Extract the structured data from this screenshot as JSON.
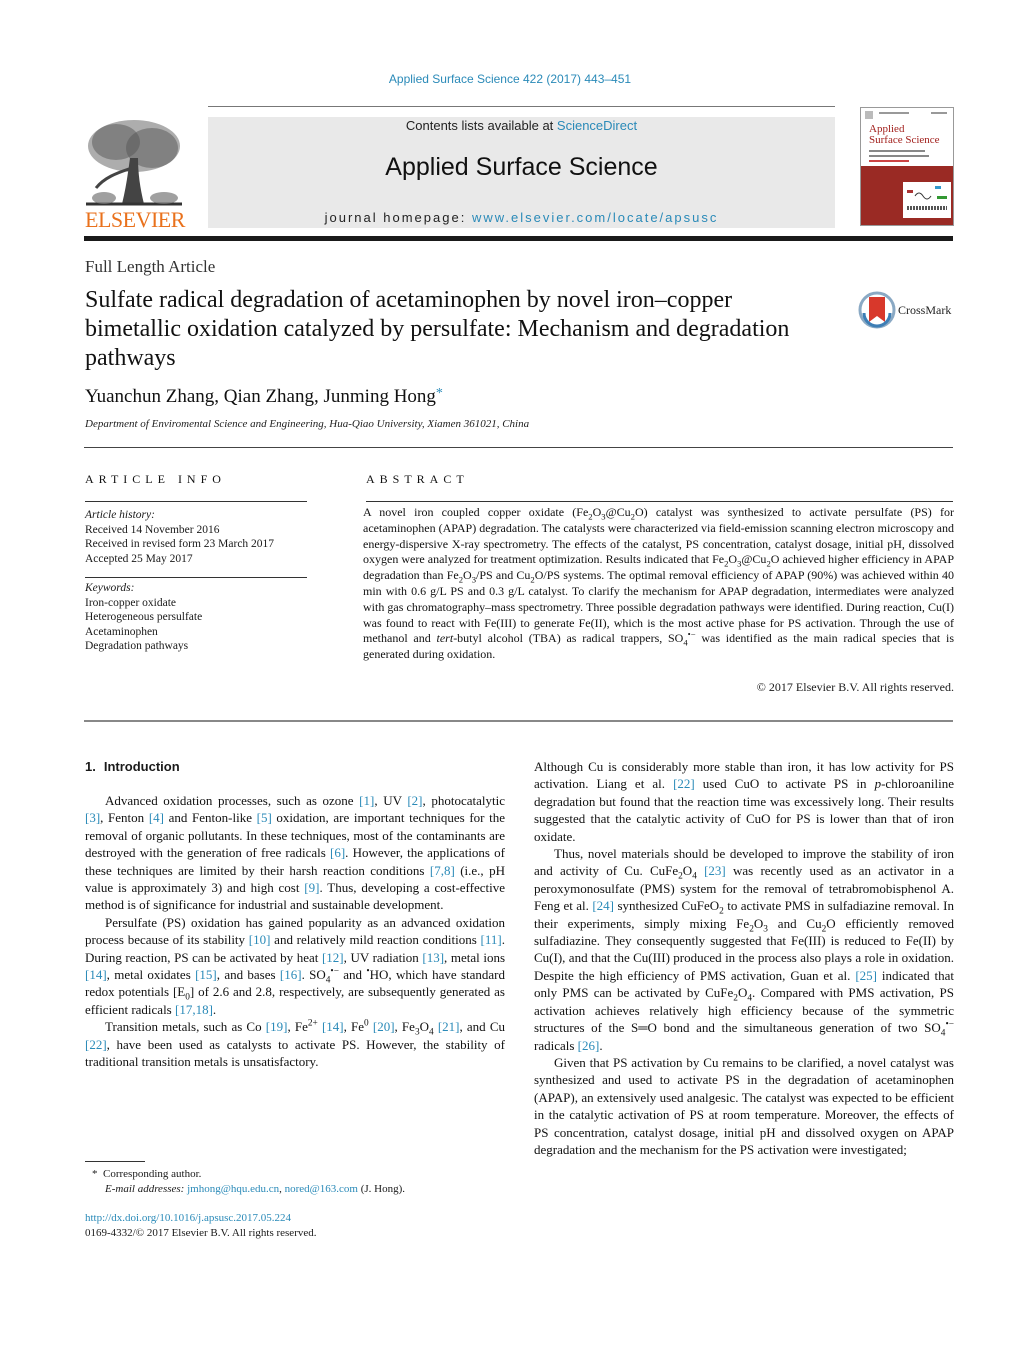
{
  "header": {
    "journal_reference": "Applied Surface Science 422 (2017) 443–451",
    "contents_prefix": "Contents lists available at ",
    "contents_link": "ScienceDirect",
    "journal_title": "Applied Surface Science",
    "homepage_prefix": "journal homepage: ",
    "homepage_link": "www.elsevier.com/locate/apsusc",
    "publisher_logo_text": "ELSEVIER",
    "cover_title_line1": "Applied",
    "cover_title_line2": "Surface Science",
    "colors": {
      "link": "#2a8ab8",
      "elsevier_orange": "#e9711c",
      "cover_red": "#9a2a24"
    }
  },
  "article": {
    "type": "Full Length Article",
    "title": "Sulfate radical degradation of acetaminophen by novel iron–copper bimetallic oxidation catalyzed by persulfate: Mechanism and degradation pathways",
    "crossmark_label": "CrossMark",
    "authors": "Yuanchun Zhang, Qian Zhang, Junming Hong",
    "corresponding_marker": "*",
    "affiliation": "Department of Enviromental Science and Engineering, Hua-Qiao University, Xiamen 361021, China"
  },
  "article_info": {
    "heading": "ARTICLE INFO",
    "history_label": "Article history:",
    "history": [
      "Received 14 November 2016",
      "Received in revised form 23 March 2017",
      "Accepted 25 May 2017"
    ],
    "keywords_label": "Keywords:",
    "keywords": [
      "Iron-copper oxidate",
      "Heterogeneous persulfate",
      "Acetaminophen",
      "Degradation pathways"
    ]
  },
  "abstract": {
    "heading": "ABSTRACT",
    "s1a": "A novel iron coupled copper oxidate (Fe",
    "s1b": "O",
    "s1c": "@Cu",
    "s1d": "O) catalyst was synthesized to activate persulfate (PS) for acetaminophen (APAP) degradation. The catalysts were characterized via field-emission scanning electron microscopy and energy-dispersive X-ray spectrometry. The effects of the catalyst, PS concentration, catalyst dosage, initial pH, dissolved oxygen were analyzed for treatment optimization. Results indicated that Fe",
    "s2a": "O",
    "s2b": "@Cu",
    "s2c": "O achieved higher efficiency in APAP degradation than Fe",
    "s2d": "O",
    "s2e": "/PS and Cu",
    "s2f": "O/PS systems. The optimal removal efficiency of APAP (90%) was achieved within 40 min with 0.6 g/L PS and 0.3 g/L catalyst. To clarify the mechanism for APAP degradation, intermediates were analyzed with gas chromatography–mass spectrometry. Three possible degradation pathways were identified. During reaction, Cu(I) was found to react with Fe(III) to generate Fe(II), which is the most active phase for PS activation. Through the use of methanol and ",
    "s3_italic": "tert",
    "s3b": "-butyl alcohol (TBA) as radical trappers, SO",
    "s3c": "main radical species that is generated during oxidation.",
    "s3c_pre": " was identified as the ",
    "radical_sup": "•−",
    "sub2": "2",
    "sub3": "3",
    "sub4": "4",
    "copyright": "© 2017 Elsevier B.V. All rights reserved."
  },
  "introduction": {
    "section_number": "1.",
    "section_title": "Introduction",
    "p1": {
      "t1": "Advanced oxidation processes, such as ozone ",
      "r1": "[1]",
      "t2": ", UV ",
      "r2": "[2]",
      "t3": ", photocatalytic ",
      "r3": "[3]",
      "t4": ", Fenton ",
      "r4": "[4]",
      "t5": " and Fenton-like ",
      "r5": "[5]",
      "t6": " oxidation, are important techniques for the removal of organic pollutants. In these techniques, most of the contaminants are destroyed with the generation of free radicals ",
      "r6": "[6]",
      "t7": ". However, the applications of these techniques are limited by their harsh reaction conditions ",
      "r7": "[7,8]",
      "t8": " (i.e., pH value is approximately 3) and high cost ",
      "r8": "[9]",
      "t9": ". Thus, developing a cost-effective method is of significance for industrial and sustainable development."
    },
    "p2": {
      "t1": "Persulfate (PS) oxidation has gained popularity as an advanced oxidation process because of its stability ",
      "r1": "[10]",
      "t2": " and relatively mild reaction conditions ",
      "r2": "[11]",
      "t3": ". During reaction, PS can be activated by heat ",
      "r3": "[12]",
      "t4": ", UV radiation ",
      "r4": "[13]",
      "t5": ", metal ions ",
      "r5": "[14]",
      "t6": ", metal oxidates ",
      "r6": "[15]",
      "t7": ", and bases ",
      "r7": "[16]",
      "t8": ". SO",
      "t8sub": "4",
      "t8sup": "•−",
      "t9": " and ",
      "t9sup": "•",
      "t10": "HO, which have standard redox potentials [E",
      "t10sub": "0",
      "t11": "] of 2.6 and 2.8, respectively, are subsequently generated as efficient radicals ",
      "r8": "[17,18]",
      "t12": "."
    },
    "p3": {
      "t1": "Transition metals, such as Co ",
      "r1": "[19]",
      "t2": ", Fe",
      "t2sup": "2+",
      "t2b": " ",
      "r2": "[14]",
      "t3": ", Fe",
      "t3sup": "0",
      "t3b": " ",
      "r3": "[20]",
      "t4": ", Fe",
      "t4sub": "3",
      "t4b": "O",
      "t4sub2": "4",
      "t4c": " ",
      "r4": "[21]",
      "t5": ", and Cu ",
      "r5": "[22]",
      "t6": ", have been used as catalysts to activate PS. However, the stability of traditional transition metals is unsatisfactory."
    },
    "p4": {
      "t1": "Although Cu is considerably more stable than iron, it has low activity for PS activation. Liang et al. ",
      "r1": "[22]",
      "t2": " used CuO to activate PS in ",
      "t2i": "p",
      "t3": "-chloroaniline degradation but found that the reaction time was excessively long. Their results suggested that the catalytic activity of CuO for PS is lower than that of iron oxidate."
    },
    "p5": {
      "t1": "Thus, novel materials should be developed to improve the stability of iron and activity of Cu. CuFe",
      "t1sub": "2",
      "t1b": "O",
      "t1sub2": "4",
      "t1c": " ",
      "r1": "[23]",
      "t2": " was recently used as an activator in a peroxymonosulfate (PMS) system for the removal of tetrabromobisphenol A. Feng et al. ",
      "r2": "[24]",
      "t3": " synthesized CuFeO",
      "t3sub": "2",
      "t4": " to activate PMS in sulfadiazine removal. In their experiments, simply mixing Fe",
      "t4sub": "2",
      "t4b": "O",
      "t4sub2": "3",
      "t5": " and Cu",
      "t5sub": "2",
      "t6": "O efficiently removed sulfadiazine. They consequently suggested that Fe(III) is reduced to Fe(II) by Cu(I), and that the Cu(III) produced in the process also plays a role in oxidation. Despite the high efficiency of PMS activation, Guan et al. ",
      "r3": "[25]",
      "t7": " indicated that only PMS can be activated by CuFe",
      "t7sub": "2",
      "t7b": "O",
      "t7sub2": "4",
      "t8": ". Compared with PMS activation, PS activation achieves relatively high efficiency because of the symmetric structures of the S═O bond and the simultaneous generation of two SO",
      "t8sub": "4",
      "t8sup": "•−",
      "t9": " radicals ",
      "r4": "[26]",
      "t10": "."
    },
    "p6": {
      "t1": "Given that PS activation by Cu remains to be clarified, a novel catalyst was synthesized and used to activate PS in the degradation of acetaminophen (APAP), an extensively used analgesic. The catalyst was expected to be efficient in the catalytic activation of PS at room temperature. Moreover, the effects of PS concentration, catalyst dosage, initial pH and dissolved oxygen on APAP degradation and the mechanism for the PS activation were investigated;"
    }
  },
  "footnotes": {
    "marker": "*",
    "corresponding": "Corresponding author.",
    "email_label": "E-mail addresses:",
    "email1": "jmhong@hqu.edu.cn",
    "email_sep": ", ",
    "email2": "nored@163.com",
    "email_suffix": " (J. Hong).",
    "doi": "http://dx.doi.org/10.1016/j.apsusc.2017.05.224",
    "issn_copyright": "0169-4332/© 2017 Elsevier B.V. All rights reserved."
  }
}
